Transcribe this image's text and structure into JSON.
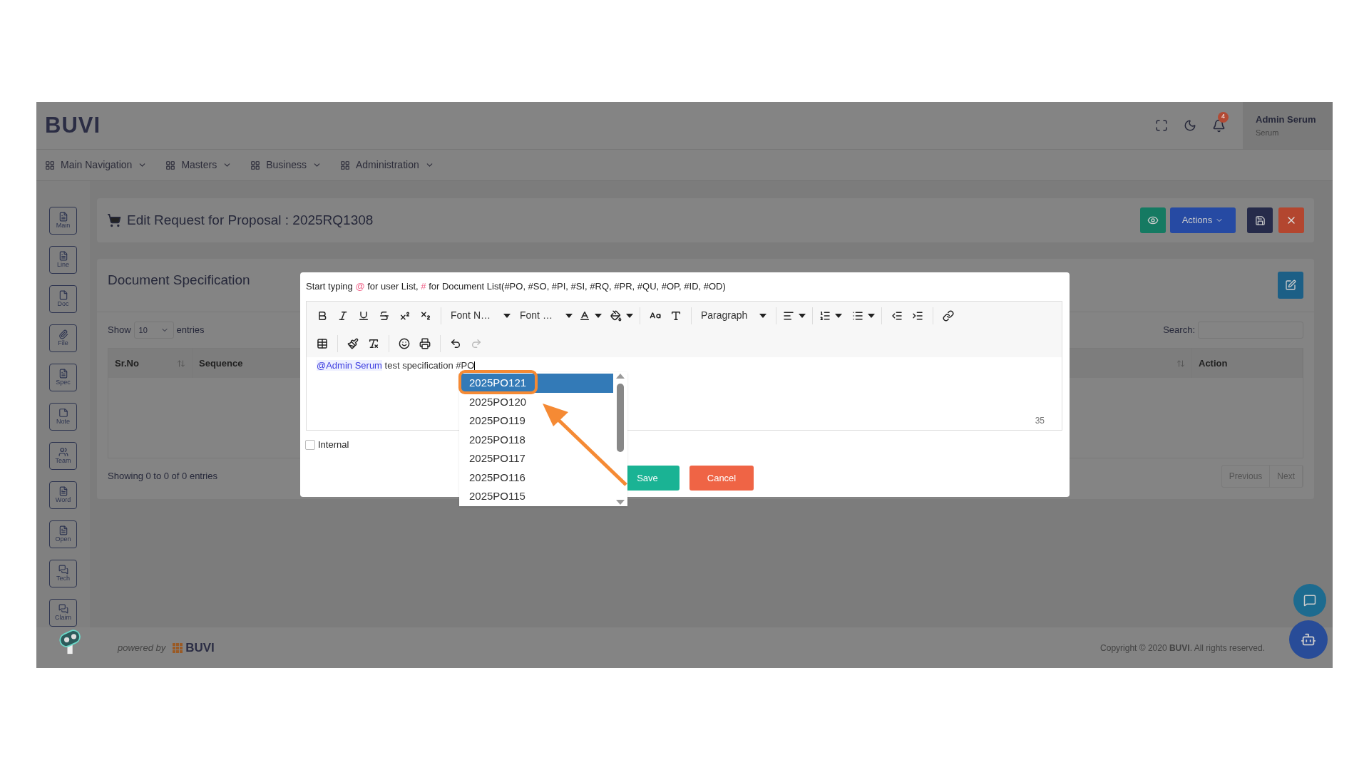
{
  "header": {
    "logo": "BUVI",
    "notifications": "4",
    "user": {
      "name": "Admin Serum",
      "role": "Serum"
    }
  },
  "nav": [
    "Main Navigation",
    "Masters",
    "Business",
    "Administration"
  ],
  "sidebar": [
    "Main",
    "Line",
    "Doc",
    "File",
    "Spec",
    "Note",
    "Team",
    "Word",
    "Open",
    "Tech",
    "Claim"
  ],
  "page": {
    "title": "Edit Request for Proposal : 2025RQ1308",
    "actions": "Actions"
  },
  "card": {
    "title": "Document Specification",
    "show": "Show",
    "page_size": "10",
    "entries": "entries",
    "search_label": "Search:",
    "columns": [
      {
        "label": "Sr.No",
        "sortable": true
      },
      {
        "label": "Sequence",
        "sortable": false
      },
      {
        "sortable": true
      },
      {
        "label": "Action",
        "sortable": false
      }
    ],
    "info": "Showing 0 to 0 of 0 entries",
    "pager": [
      "Previous",
      "Next"
    ]
  },
  "modal": {
    "hint": [
      {
        "text": "Start typing ",
        "accent": false
      },
      {
        "text": "@",
        "accent": true
      },
      {
        "text": " for user List, ",
        "accent": false
      },
      {
        "text": "#",
        "accent": true
      },
      {
        "text": " for Document List(#PO, #SO, #PI, #SI, #RQ, #PR, #QU, #OP, #ID, #OD)",
        "accent": false
      }
    ],
    "toolbar": {
      "font_name": "Font N…",
      "font_size": "Font …",
      "block": "Paragraph",
      "redo_disabled": true
    },
    "mention": "@Admin Serum",
    "content": " test specification #PO",
    "counter": "35",
    "internal": {
      "label": "Internal",
      "checked": false
    },
    "save": "Save",
    "cancel": "Cancel",
    "suggestions": [
      {
        "label": "2025PO121",
        "selected": true
      },
      {
        "label": "2025PO120",
        "selected": false
      },
      {
        "label": "2025PO119",
        "selected": false
      },
      {
        "label": "2025PO118",
        "selected": false
      },
      {
        "label": "2025PO117",
        "selected": false
      },
      {
        "label": "2025PO116",
        "selected": false
      },
      {
        "label": "2025PO115",
        "selected": false
      }
    ]
  },
  "footer": {
    "powered": "powered by",
    "brand": "BUVI",
    "copyright": "Copyright © 2020 **BUVI**. All rights reserved."
  }
}
